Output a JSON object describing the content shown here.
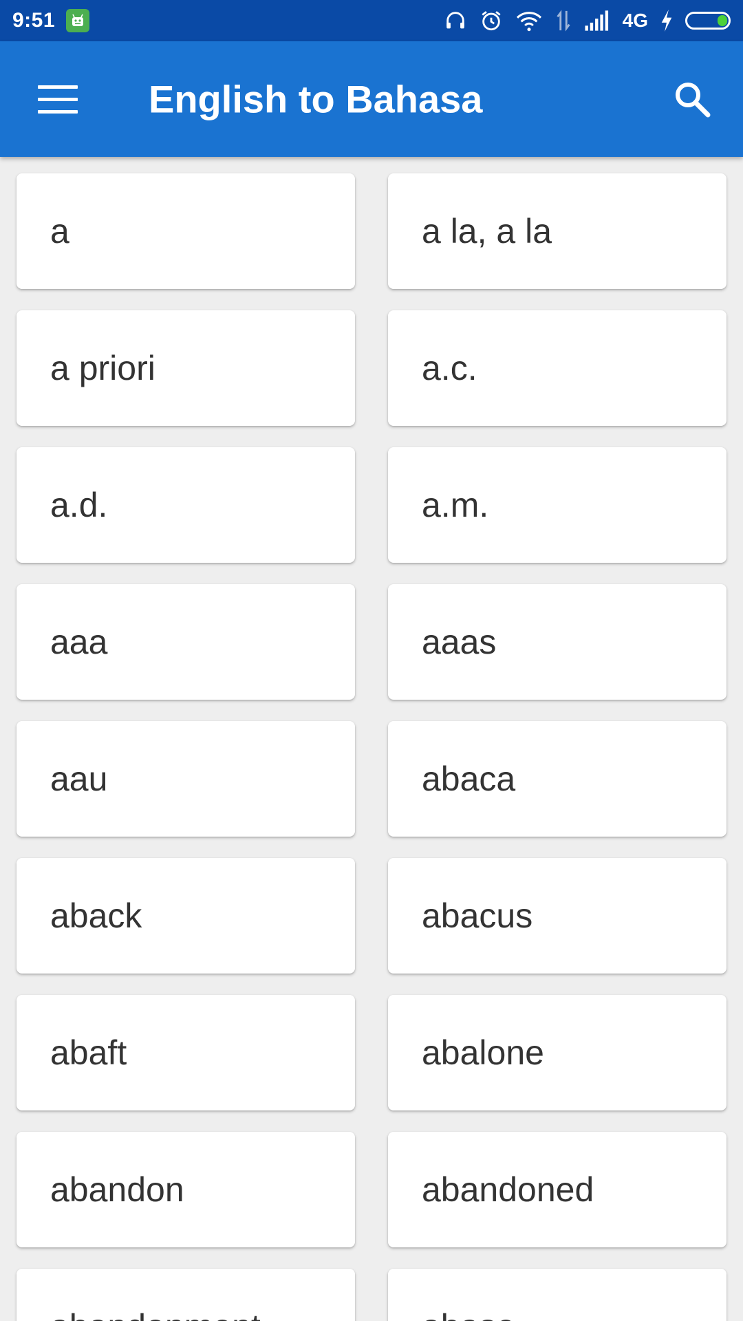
{
  "status_bar": {
    "time": "9:51",
    "app_icon": "android-icon",
    "network_label": "4G",
    "icons": [
      "headphones-icon",
      "alarm-icon",
      "wifi-icon",
      "data-transfer-icon",
      "signal-icon",
      "charging-bolt-icon",
      "battery-icon"
    ],
    "battery_level": 0.25
  },
  "app_bar": {
    "title": "English to Bahasa",
    "menu_icon": "hamburger-menu-icon",
    "search_icon": "search-icon",
    "background_color": "#1a73d1"
  },
  "words": [
    "a",
    "a la, a la",
    "a priori",
    "a.c.",
    "a.d.",
    "a.m.",
    "aaa",
    "aaas",
    "aau",
    "abaca",
    "aback",
    "abacus",
    "abaft",
    "abalone",
    "abandon",
    "abandoned",
    "abandonment",
    "abase"
  ]
}
